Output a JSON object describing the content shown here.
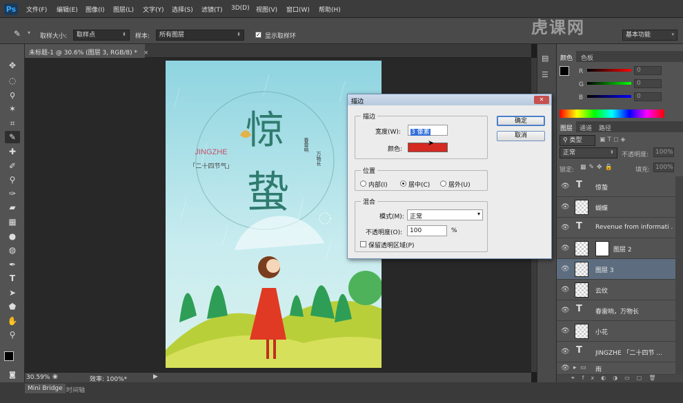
{
  "app": {
    "logo": "Ps"
  },
  "menu": [
    "文件(F)",
    "编辑(E)",
    "图像(I)",
    "图层(L)",
    "文字(Y)",
    "选择(S)",
    "滤镜(T)",
    "3D(D)",
    "视图(V)",
    "窗口(W)",
    "帮助(H)"
  ],
  "options": {
    "sample_size_label": "取样大小:",
    "sample_size_value": "取样点",
    "sample_label": "样本:",
    "sample_value": "所有图层",
    "show_ring_label": "显示取样环",
    "workspace": "基本功能"
  },
  "document": {
    "tab_title": "未标题-1 @ 30.6% (图层 3, RGB/8) *",
    "zoom": "30.59%",
    "efficiency": "效率: 100%*"
  },
  "poster": {
    "title_top": "惊",
    "title_bottom": "蛰",
    "pinyin": "JINGZHE",
    "subtitle": "「二十四节气」",
    "side_text_1": "春雷响",
    "side_text_2": "万物长"
  },
  "bottom_tabs": [
    "Mini Bridge",
    "时间轴"
  ],
  "color_panel": {
    "tabs": [
      "颜色",
      "色板"
    ],
    "r": "R",
    "g": "G",
    "b": "B",
    "r_val": "0",
    "g_val": "0",
    "b_val": "0"
  },
  "layers_panel": {
    "tabs": [
      "图层",
      "通道",
      "路径"
    ],
    "filter_label": "类型",
    "blend_mode": "正常",
    "opacity_label": "不透明度:",
    "opacity_value": "100%",
    "lock_label": "锁定:",
    "fill_label": "填充:",
    "fill_value": "100%",
    "layers": [
      {
        "type": "text",
        "name": "惊蛰"
      },
      {
        "type": "pixel",
        "name": "蝴蝶"
      },
      {
        "type": "text",
        "name": "Revenue from informati ..."
      },
      {
        "type": "mask",
        "name": "图层 2"
      },
      {
        "type": "pixel",
        "name": "图层 3",
        "selected": true
      },
      {
        "type": "pixel",
        "name": "云纹"
      },
      {
        "type": "text",
        "name": "春雷响，万物长"
      },
      {
        "type": "pixel",
        "name": "小花"
      },
      {
        "type": "text",
        "name": "JINGZHE 「二十四节 ..."
      },
      {
        "type": "folder",
        "name": "雨"
      }
    ]
  },
  "dialog": {
    "title": "描边",
    "stroke_group": "描边",
    "width_label": "宽度(W):",
    "width_value": "3 像素",
    "color_label": "颜色:",
    "stroke_color": "#d42a21",
    "position_group": "位置",
    "inside": "内部(I)",
    "center": "居中(C)",
    "outside": "居外(U)",
    "blend_group": "混合",
    "mode_label": "模式(M):",
    "mode_value": "正常",
    "opacity_label": "不透明度(O):",
    "opacity_value": "100",
    "percent": "%",
    "preserve_label": "保留透明区域(P)",
    "ok": "确定",
    "cancel": "取消"
  },
  "watermark": "虎课网"
}
